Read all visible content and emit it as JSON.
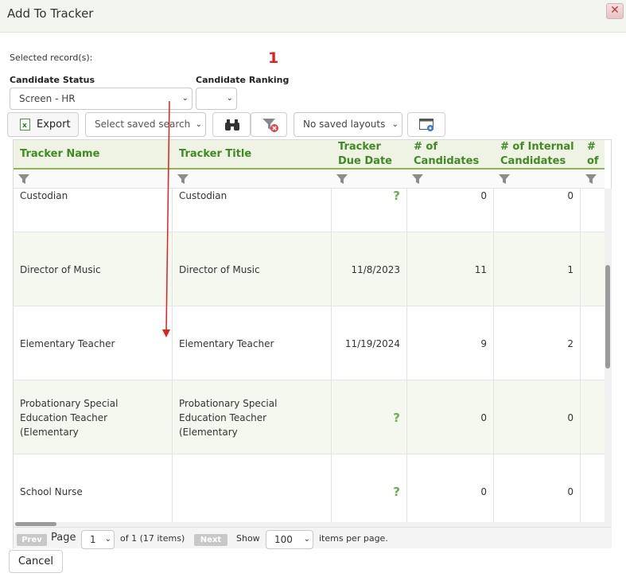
{
  "dialog": {
    "title": "Add To Tracker",
    "close_glyph": "✕"
  },
  "selection": {
    "label": "Selected record(s):",
    "count": "1"
  },
  "filters": {
    "status_label": "Candidate Status",
    "status_value": "Screen - HR",
    "ranking_label": "Candidate Ranking",
    "ranking_value": ""
  },
  "toolbar": {
    "export_label": "Export",
    "saved_search_placeholder": "Select saved search",
    "layouts_value": "No saved layouts"
  },
  "grid": {
    "columns": [
      "Tracker Name",
      "Tracker Title",
      "Tracker Due Date",
      "# of Candidates",
      "# of Internal Candidates",
      "# of Candidates"
    ],
    "rows": [
      {
        "name": "Custodian",
        "title": "Custodian",
        "due": "?",
        "candidates": "0",
        "internal": "0"
      },
      {
        "name": "Director of Music",
        "title": "Director of Music",
        "due": "11/8/2023",
        "candidates": "11",
        "internal": "1"
      },
      {
        "name": "Elementary Teacher",
        "title": "Elementary Teacher",
        "due": "11/19/2024",
        "candidates": "9",
        "internal": "2"
      },
      {
        "name": "Probationary Special Education Teacher (Elementary",
        "title": "Probationary Special Education Teacher (Elementary",
        "due": "?",
        "candidates": "0",
        "internal": "0"
      },
      {
        "name": "School Nurse",
        "title": "",
        "due": "?",
        "candidates": "0",
        "internal": "0"
      }
    ]
  },
  "pager": {
    "prev": "Prev",
    "page_label": "Page",
    "page_value": "1",
    "of_text": "of 1 (17 items)",
    "next": "Next",
    "show_label": "Show",
    "size_value": "100",
    "per_page": "items per page."
  },
  "footer": {
    "cancel_label": "Cancel"
  },
  "colors": {
    "header_text": "#3f8a22",
    "accent_line": "#94b355",
    "annotation": "#dd2222"
  }
}
